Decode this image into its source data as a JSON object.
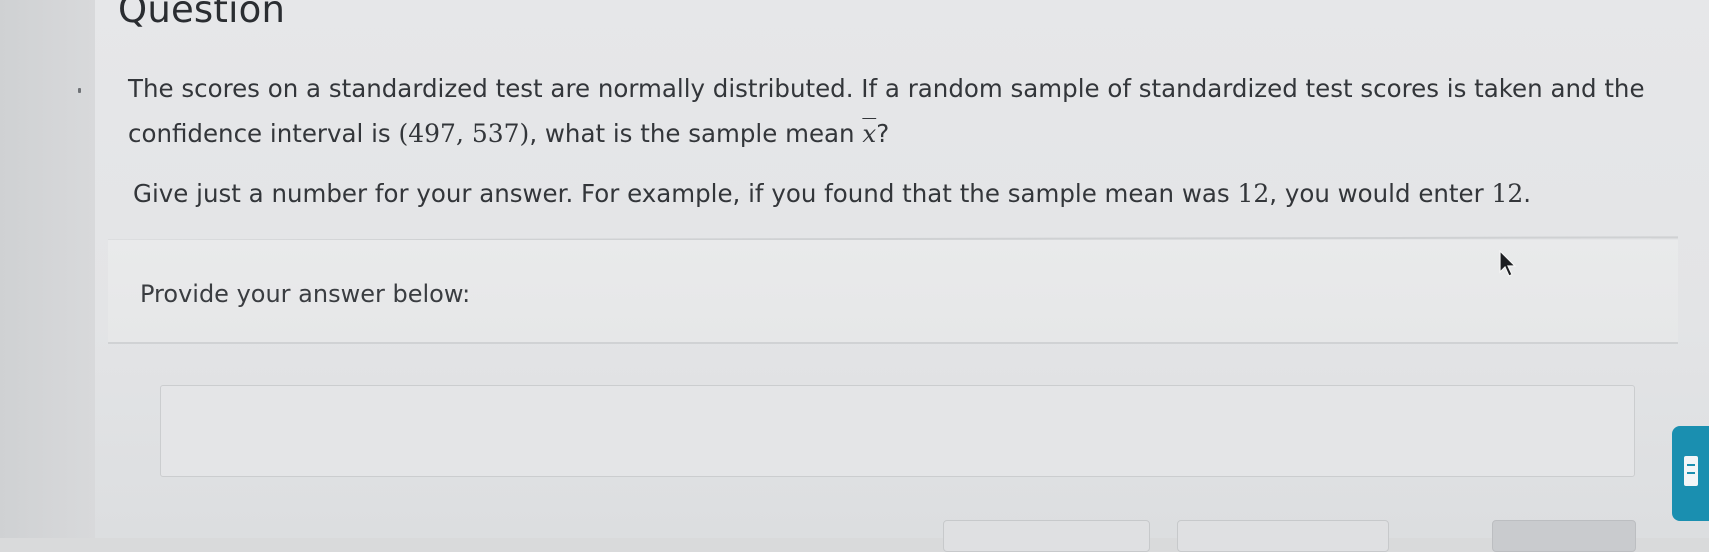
{
  "question": {
    "title": "Question",
    "text_part1": "The scores on a standardized test are normally distributed. If a random sample of standardized test scores is taken and the confidence interval is ",
    "interval": "(497, 537)",
    "text_part2": ", what is the sample mean ",
    "symbol": "x",
    "text_part3": "?",
    "instruction_part1": "Give just a number for your answer. For example, if you found that the sample mean was ",
    "example_value": "12",
    "instruction_part2": ", you would enter ",
    "example_value_2": "12",
    "instruction_part3": "."
  },
  "answer": {
    "label": "Provide your answer below:",
    "value": ""
  },
  "colors": {
    "accent": "#1a8fb0"
  },
  "icons": {
    "cursor": "mouse-cursor-icon",
    "side_tab": "list-icon"
  }
}
